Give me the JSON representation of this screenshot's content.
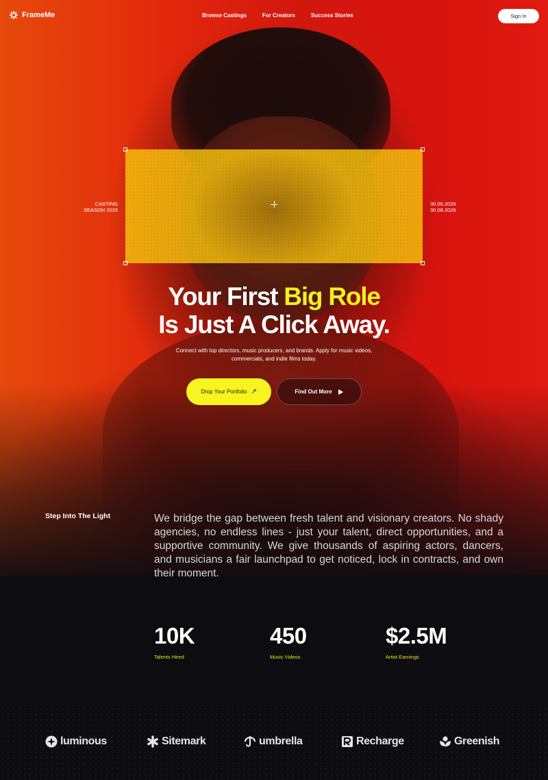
{
  "nav": {
    "logo_text": "FrameMe",
    "links": [
      "Browse Castings",
      "For Creators",
      "Success Stories"
    ],
    "signin_label": "Sign In"
  },
  "hero": {
    "left_label_line1": "CASTING",
    "left_label_line2": "SEASON 2026",
    "right_label_line1": "30.06.2026",
    "right_label_line2": "30.08.2026",
    "headline_part1": "Your First ",
    "headline_highlight": "Big Role",
    "headline_line2": "Is Just A Click Away.",
    "subtext": "Connect with top directors, music producers, and brands. Apply for music videos, commercials, and indie films today.",
    "primary_button": "Drop Your Portfolio",
    "secondary_button": "Find Out More"
  },
  "about": {
    "label": "Step Into The Light",
    "text": "We bridge the gap between fresh talent and visionary creators. No shady agencies, no endless lines - just your talent, direct opportunities, and a supportive community. We give thousands of aspiring actors, dancers, and musicians a fair launchpad to get noticed, lock in contracts, and own their moment."
  },
  "stats": [
    {
      "value": "10K",
      "label": "Talents Hired"
    },
    {
      "value": "450",
      "label": "Music Videos"
    },
    {
      "value": "$2.5M",
      "label": "Artist Earnings"
    }
  ],
  "brands": [
    {
      "name": "luminous",
      "icon": "plus-star-icon"
    },
    {
      "name": "Sitemark",
      "icon": "asterisk-icon"
    },
    {
      "name": "umbrella",
      "icon": "umbrella-icon"
    },
    {
      "name": "Recharge",
      "icon": "r-logo-icon"
    },
    {
      "name": "Greenish",
      "icon": "leaf-icon"
    }
  ],
  "colors": {
    "accent_yellow": "#f7f41f",
    "hero_red": "#d8140e",
    "background_dark": "#0d0c10"
  }
}
